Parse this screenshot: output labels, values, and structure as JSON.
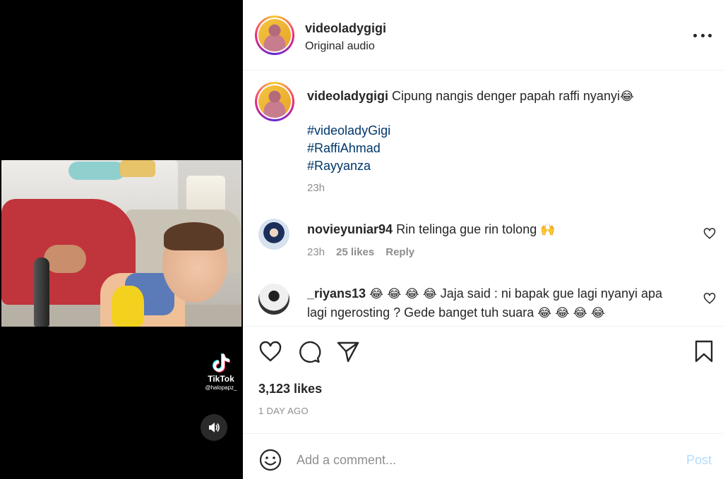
{
  "video": {
    "tiktok_brand": "TikTok",
    "tiktok_handle": "@halopapz_",
    "mute_icon": "speaker-icon"
  },
  "header": {
    "username": "videoladygigi",
    "subtitle": "Original audio",
    "more_icon": "more-horizontal-icon"
  },
  "caption": {
    "username": "videoladygigi",
    "text": "Cipung nangis denger papah raffi nyanyi",
    "emoji": "😂",
    "hashtags": [
      "#videoladyGigi",
      "#RaffiAhmad",
      "#Rayyanza"
    ],
    "time": "23h"
  },
  "comments": [
    {
      "username": "novieyuniar94",
      "text": "Rin telinga gue rin tolong",
      "emoji": "🙌",
      "time": "23h",
      "likes": "25 likes",
      "reply": "Reply"
    },
    {
      "username": "_riyans13",
      "lead_emoji": "😂 😂 😂 😂",
      "text_line1": "Jaja said : ni bapak gue lagi nyanyi apa",
      "text_line2": "lagi ngerosting ? Gede banget tuh suara",
      "trail_emoji": "😂 😂 😂 😂"
    }
  ],
  "actions": {
    "likes": "3,123 likes",
    "date": "1 DAY AGO"
  },
  "add_comment": {
    "placeholder": "Add a comment...",
    "post_label": "Post"
  },
  "colors": {
    "hashtag": "#00376b",
    "muted": "#8e8e8e",
    "post_disabled": "#b3dbff",
    "text": "#262626"
  }
}
